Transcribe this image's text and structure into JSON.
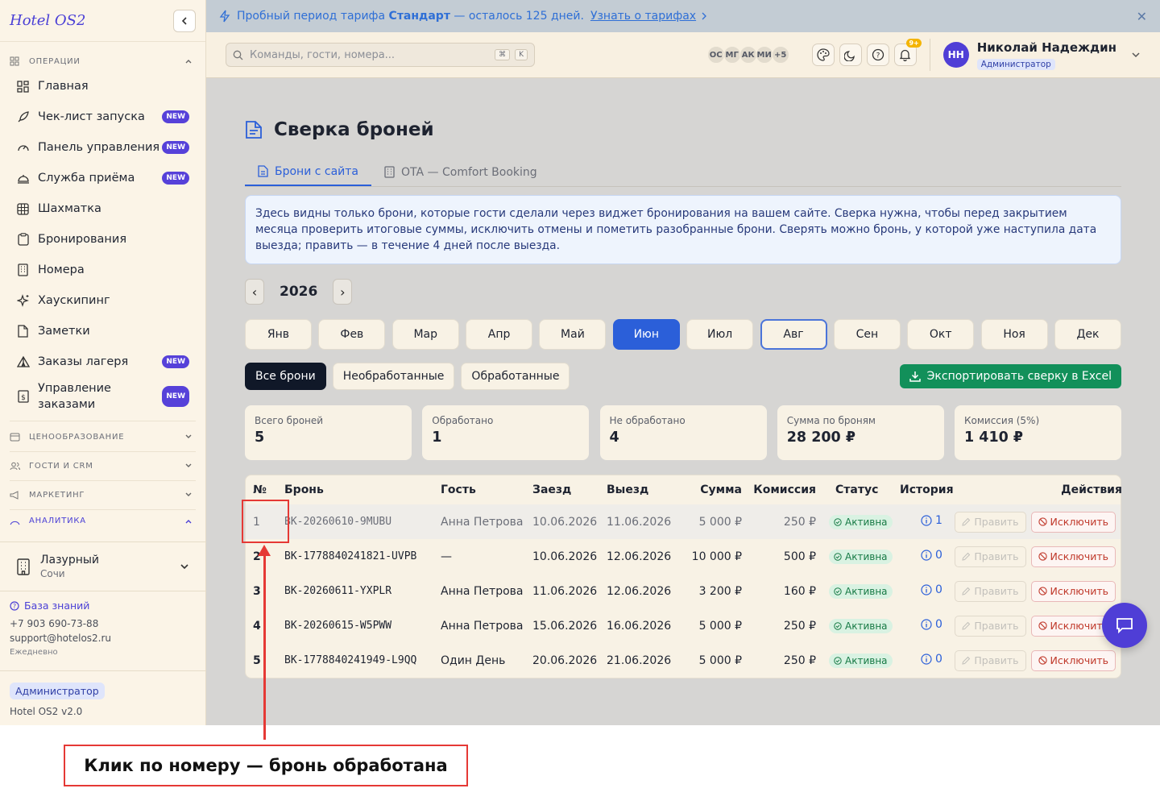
{
  "app": {
    "brand": "Hotel OS2",
    "version": "Hotel OS2 v2.0"
  },
  "sidebar": {
    "sections": {
      "operations": "ОПЕРАЦИИ",
      "pricing": "ЦЕНООБРАЗОВАНИЕ",
      "guests": "ГОСТИ И CRM",
      "marketing": "МАРКЕТИНГ",
      "analytics": "АНАЛИТИКА"
    },
    "items": [
      {
        "label": "Главная",
        "new": ""
      },
      {
        "label": "Чек-лист запуска",
        "new": "NEW"
      },
      {
        "label": "Панель управления",
        "new": "NEW"
      },
      {
        "label": "Служба приёма",
        "new": "NEW"
      },
      {
        "label": "Шахматка",
        "new": ""
      },
      {
        "label": "Бронирования",
        "new": ""
      },
      {
        "label": "Номера",
        "new": ""
      },
      {
        "label": "Хаускипинг",
        "new": ""
      },
      {
        "label": "Заметки",
        "new": ""
      },
      {
        "label": "Заказы лагеря",
        "new": "NEW"
      },
      {
        "label": "Управление заказами",
        "new": "NEW"
      }
    ],
    "hotel": {
      "name": "Лазурный",
      "city": "Сочи"
    },
    "support": {
      "kb": "База знаний",
      "phone": "+7 903 690-73-88",
      "email": "support@hotelos2.ru",
      "hours": "Ежедневно"
    },
    "role": "Администратор"
  },
  "banner": {
    "prefix": "Пробный период тарифа",
    "plan": "Стандарт",
    "suffix": "— осталось 125 дней.",
    "link": "Узнать о тарифах",
    "close": "✕"
  },
  "topbar": {
    "search_placeholder": "Команды, гости, номера...",
    "kbd1": "⌘",
    "kbd2": "K",
    "avatars": [
      "ОС",
      "МГ",
      "АК",
      "МИ",
      "+5"
    ],
    "notif_count": "9+",
    "user": {
      "initials": "НН",
      "name": "Николай Надеждин",
      "role": "Администратор"
    }
  },
  "page": {
    "title": "Сверка броней",
    "tabs": [
      "Брони с сайта",
      "OTA — Comfort Booking"
    ],
    "info": "Здесь видны только брони, которые гости сделали через виджет бронирования на вашем сайте. Сверка нужна, чтобы перед закрытием месяца проверить итоговые суммы, исключить отмены и пометить разобранные брони. Сверять можно бронь, у которой уже наступила дата выезда; править — в течение 4 дней после выезда.",
    "year": "2026",
    "prev": "‹",
    "next": "›",
    "months": [
      "Янв",
      "Фев",
      "Мар",
      "Апр",
      "Май",
      "Июн",
      "Июл",
      "Авг",
      "Сен",
      "Окт",
      "Ноя",
      "Дек"
    ],
    "filters": [
      "Все брони",
      "Необработанные",
      "Обработанные"
    ],
    "export": "Экспортировать сверку в Excel",
    "stats": [
      {
        "label": "Всего броней",
        "value": "5"
      },
      {
        "label": "Обработано",
        "value": "1"
      },
      {
        "label": "Не обработано",
        "value": "4"
      },
      {
        "label": "Сумма по броням",
        "value": "28 200 ₽"
      },
      {
        "label": "Комиссия (5%)",
        "value": "1 410 ₽"
      }
    ]
  },
  "table": {
    "headers": [
      "№",
      "Бронь",
      "Гость",
      "Заезд",
      "Выезд",
      "Сумма",
      "Комиссия",
      "Статус",
      "История",
      "Действия"
    ],
    "edit_label": "Править",
    "exclude_label": "Исключить",
    "rows": [
      {
        "num": "1",
        "id": "BK-20260610-9MUBU",
        "guest": "Анна Петрова",
        "in": "10.06.2026",
        "out": "11.06.2026",
        "sum": "5 000 ₽",
        "com": "250 ₽",
        "status": "Активна",
        "hist": "1"
      },
      {
        "num": "2",
        "id": "BK-1778840241821-UVPB",
        "guest": "—",
        "in": "10.06.2026",
        "out": "12.06.2026",
        "sum": "10 000 ₽",
        "com": "500 ₽",
        "status": "Активна",
        "hist": "0"
      },
      {
        "num": "3",
        "id": "BK-20260611-YXPLR",
        "guest": "Анна Петрова",
        "in": "11.06.2026",
        "out": "12.06.2026",
        "sum": "3 200 ₽",
        "com": "160 ₽",
        "status": "Активна",
        "hist": "0"
      },
      {
        "num": "4",
        "id": "BK-20260615-W5PWW",
        "guest": "Анна Петрова",
        "in": "15.06.2026",
        "out": "16.06.2026",
        "sum": "5 000 ₽",
        "com": "250 ₽",
        "status": "Активна",
        "hist": "0"
      },
      {
        "num": "5",
        "id": "BK-1778840241949-L9QQ",
        "guest": "Один День",
        "in": "20.06.2026",
        "out": "21.06.2026",
        "sum": "5 000 ₽",
        "com": "250 ₽",
        "status": "Активна",
        "hist": "0"
      }
    ]
  },
  "annotation": {
    "callout": "Клик по номеру — бронь обработана"
  },
  "colors": {
    "accent": "#2b5fd9",
    "brand": "#4f3ed6",
    "success": "#12905a",
    "danger": "#e53935"
  }
}
